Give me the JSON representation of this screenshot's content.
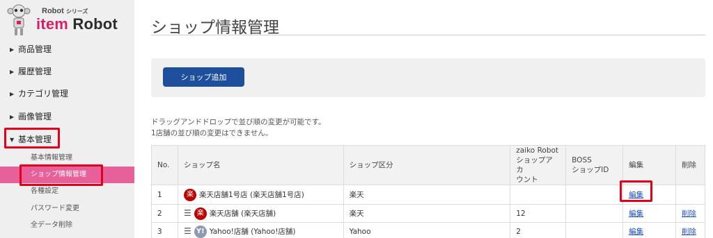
{
  "logo": {
    "series": "Robot",
    "series_suffix": "シリーズ",
    "brand_prefix": "item",
    "brand_suffix": " Robot"
  },
  "nav": [
    {
      "label": "商品管理",
      "caret": "▶"
    },
    {
      "label": "履歴管理",
      "caret": "▶"
    },
    {
      "label": "カテゴリ管理",
      "caret": "▶"
    },
    {
      "label": "画像管理",
      "caret": "▶"
    },
    {
      "label": "基本管理",
      "caret": "▼"
    }
  ],
  "subnav": {
    "basic_info": "基本情報管理",
    "shop_info": "ショップ情報管理",
    "settings": "各種設定",
    "password": "パスワード変更",
    "delete_all": "全データ削除"
  },
  "page": {
    "title": "ショップ情報管理"
  },
  "actions": {
    "add_shop": "ショップ追加"
  },
  "notes": {
    "line1": "ドラッグアンドドロップで並び順の変更が可能です。",
    "line2": "1店舗の並び順の変更はできません。"
  },
  "table": {
    "headers": {
      "no": "No.",
      "shop_name": "ショップ名",
      "shop_type": "ショップ区分",
      "zaiko_line1": "zaiko Robot",
      "zaiko_line2": "ショップアカ",
      "zaiko_line3": "ウント",
      "boss_line1": "BOSS",
      "boss_line2": "ショップID",
      "edit": "編集",
      "delete": "削除"
    },
    "rows": [
      {
        "no": "1",
        "icon": "楽",
        "name": "楽天店舗1号店 (楽天店舗1号店)",
        "type": "楽天",
        "zaiko": "",
        "boss": "",
        "edit": "編集",
        "delete": ""
      },
      {
        "no": "2",
        "icon": "楽",
        "name": "楽天店舗 (楽天店舗)",
        "type": "楽天",
        "zaiko": "12",
        "boss": "",
        "edit": "編集",
        "delete": "削除"
      },
      {
        "no": "3",
        "icon": "Y!",
        "name": "Yahoo!店舗 (Yahoo!店舗)",
        "type": "Yahoo",
        "zaiko": "2",
        "boss": "",
        "edit": "編集",
        "delete": "削除"
      }
    ]
  },
  "colors": {
    "accent_pink": "#e8609a",
    "primary_button": "#1e4f9c",
    "highlight": "#e3001b",
    "link": "#1f4fc6"
  }
}
